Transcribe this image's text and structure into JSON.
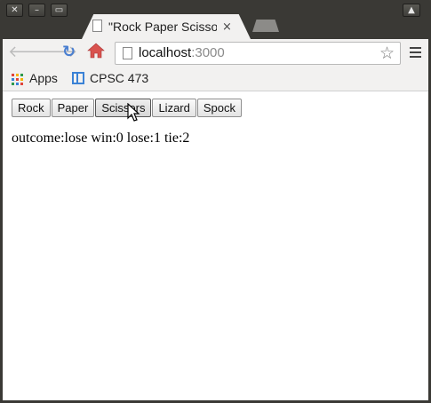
{
  "browser": {
    "tab_title": "\"Rock Paper Scissors",
    "tab_close": "×",
    "url_host": "localhost",
    "url_port": ":3000",
    "bookmarks": [
      {
        "label": "Apps"
      },
      {
        "label": "CPSC 473"
      }
    ],
    "apps_colors": [
      "#e0453b",
      "#f5b400",
      "#2e9a4b",
      "#3b82d6",
      "#e0453b",
      "#f5b400",
      "#2e9a4b",
      "#3b82d6",
      "#e0453b"
    ]
  },
  "game": {
    "buttons": [
      "Rock",
      "Paper",
      "Scissors",
      "Lizard",
      "Spock"
    ],
    "status_text": "outcome:lose win:0 lose:1 tie:2"
  }
}
